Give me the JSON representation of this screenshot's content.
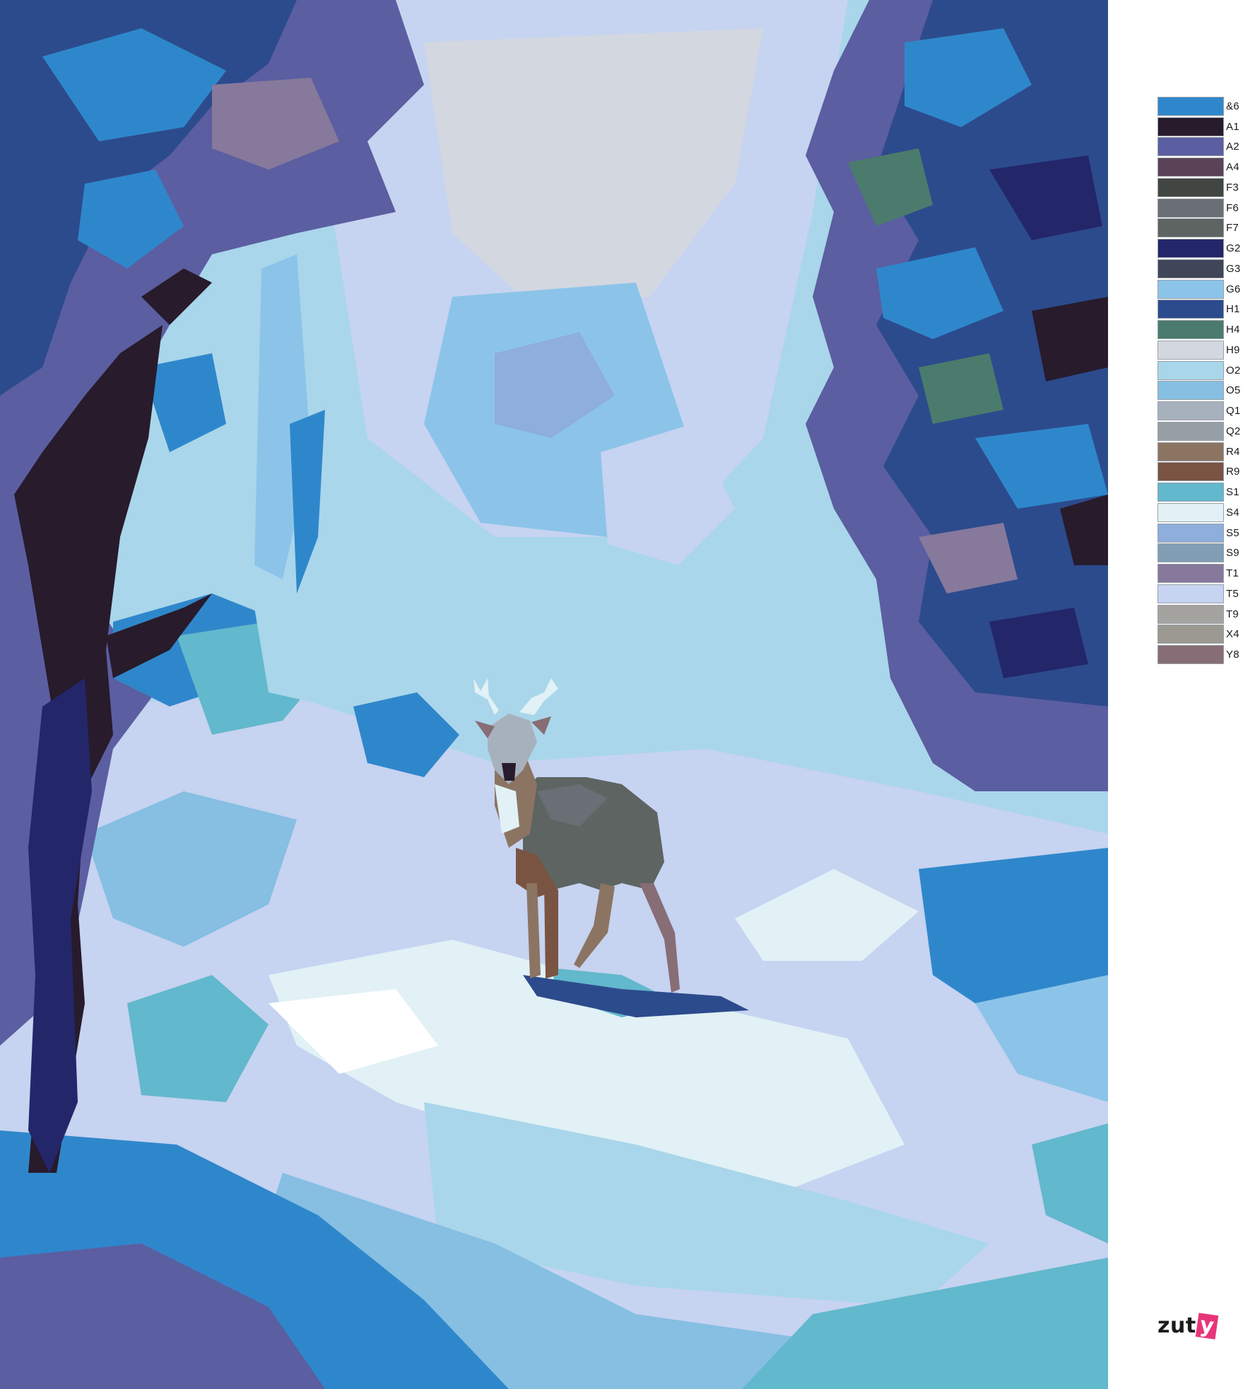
{
  "palette": [
    {
      "code": "&6",
      "color": "#2f87cb"
    },
    {
      "code": "A1",
      "color": "#271b2c"
    },
    {
      "code": "A2",
      "color": "#5b5ea0"
    },
    {
      "code": "A4",
      "color": "#5a4356"
    },
    {
      "code": "F3",
      "color": "#414642"
    },
    {
      "code": "F6",
      "color": "#6a6e75"
    },
    {
      "code": "F7",
      "color": "#5d6462"
    },
    {
      "code": "G2",
      "color": "#24266a"
    },
    {
      "code": "G3",
      "color": "#404659"
    },
    {
      "code": "G6",
      "color": "#8cc4e9"
    },
    {
      "code": "H1",
      "color": "#2c4b8d"
    },
    {
      "code": "H4",
      "color": "#4b7b6d"
    },
    {
      "code": "H9",
      "color": "#d3d7e0"
    },
    {
      "code": "O2",
      "color": "#a9d6ea"
    },
    {
      "code": "O5",
      "color": "#86bfe2"
    },
    {
      "code": "Q1",
      "color": "#a7b1bd"
    },
    {
      "code": "Q2",
      "color": "#969fa6"
    },
    {
      "code": "R4",
      "color": "#8c7463"
    },
    {
      "code": "R9",
      "color": "#7a5443"
    },
    {
      "code": "S1",
      "color": "#62b8cc"
    },
    {
      "code": "S4",
      "color": "#e1f1f5"
    },
    {
      "code": "S5",
      "color": "#8eaedb"
    },
    {
      "code": "S9",
      "color": "#819eb5"
    },
    {
      "code": "T1",
      "color": "#86799c"
    },
    {
      "code": "T5",
      "color": "#c6d3f1"
    },
    {
      "code": "T9",
      "color": "#a5a3a0"
    },
    {
      "code": "X4",
      "color": "#9b9991"
    },
    {
      "code": "Y8",
      "color": "#876d75"
    }
  ],
  "logo": {
    "text_main": "zut",
    "text_accent": "y"
  }
}
